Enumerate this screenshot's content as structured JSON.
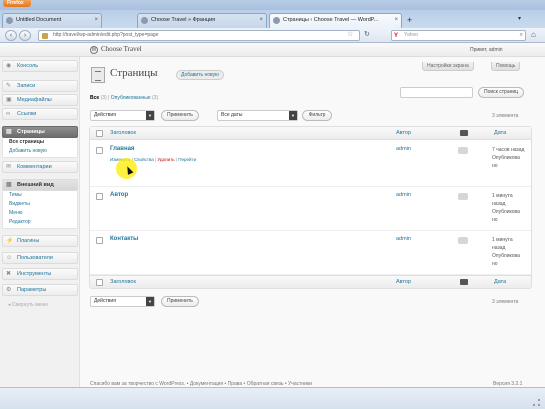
{
  "browser": {
    "menu_label": "Firefox",
    "tabs": [
      {
        "label": "Untitled Document"
      },
      {
        "label": "Choose Travel » Франция"
      },
      {
        "label": "Страницы ‹ Choose Travel — WordP..."
      },
      {
        "label": "Choose Travel"
      }
    ],
    "url": "http://travel/wp-admin/edit.php?post_type=page",
    "search_placeholder": "Yahoo"
  },
  "header": {
    "site_title": "Choose Travel",
    "howdy": "Привет, admin"
  },
  "sidebar": {
    "items": [
      {
        "label": "Консоль",
        "icon": "dashboard-icon"
      },
      {
        "label": "Записи",
        "icon": "pin-icon"
      },
      {
        "label": "Медиафайлы",
        "icon": "media-icon"
      },
      {
        "label": "Ссылки",
        "icon": "link-icon"
      },
      {
        "label": "Страницы",
        "icon": "pages-icon"
      },
      {
        "label": "Комментарии",
        "icon": "comments-icon"
      },
      {
        "label": "Внешний вид",
        "icon": "appearance-icon"
      },
      {
        "label": "Плагины",
        "icon": "plugins-icon"
      },
      {
        "label": "Пользователи",
        "icon": "users-icon"
      },
      {
        "label": "Инструменты",
        "icon": "tools-icon"
      },
      {
        "label": "Параметры",
        "icon": "settings-icon"
      }
    ],
    "pages_sub": [
      "Все страницы",
      "Добавить новую"
    ],
    "appearance_sub": [
      "Темы",
      "Виджеты",
      "Меню",
      "Редактор"
    ],
    "collapse": "Свернуть меню"
  },
  "main": {
    "title": "Страницы",
    "add_new": "Добавить новую",
    "screen_options": "Настройки экрана",
    "help": "Помощь",
    "filters": {
      "all": "Все",
      "all_count": "(3)",
      "sep": "|",
      "published": "Опубликованные",
      "published_count": "(3)"
    },
    "search_button": "Поиск страниц",
    "bulk_select": "Действия",
    "apply": "Применить",
    "dates_select": "Все даты",
    "filter_button": "Фильтр",
    "items_count": "3 элемента",
    "columns": {
      "title": "Заголовок",
      "author": "Автор",
      "date": "Дата"
    },
    "rows": [
      {
        "title": "Главная",
        "author": "admin",
        "date": "7 часов назад Опубликова но",
        "actions": {
          "edit": "Изменить",
          "props": "Свойства",
          "del": "Удалить",
          "view": "Перейти"
        }
      },
      {
        "title": "Автор",
        "author": "admin",
        "date": "1 минута назад Опубликова но"
      },
      {
        "title": "Контакты",
        "author": "admin",
        "date": "1 минута назад Опубликова но"
      }
    ]
  },
  "footer": {
    "text": "Спасибо вам за творчество с WordPress. • Документация • Права • Обратная связь • Участники",
    "version": "Версия 3.2.1"
  }
}
